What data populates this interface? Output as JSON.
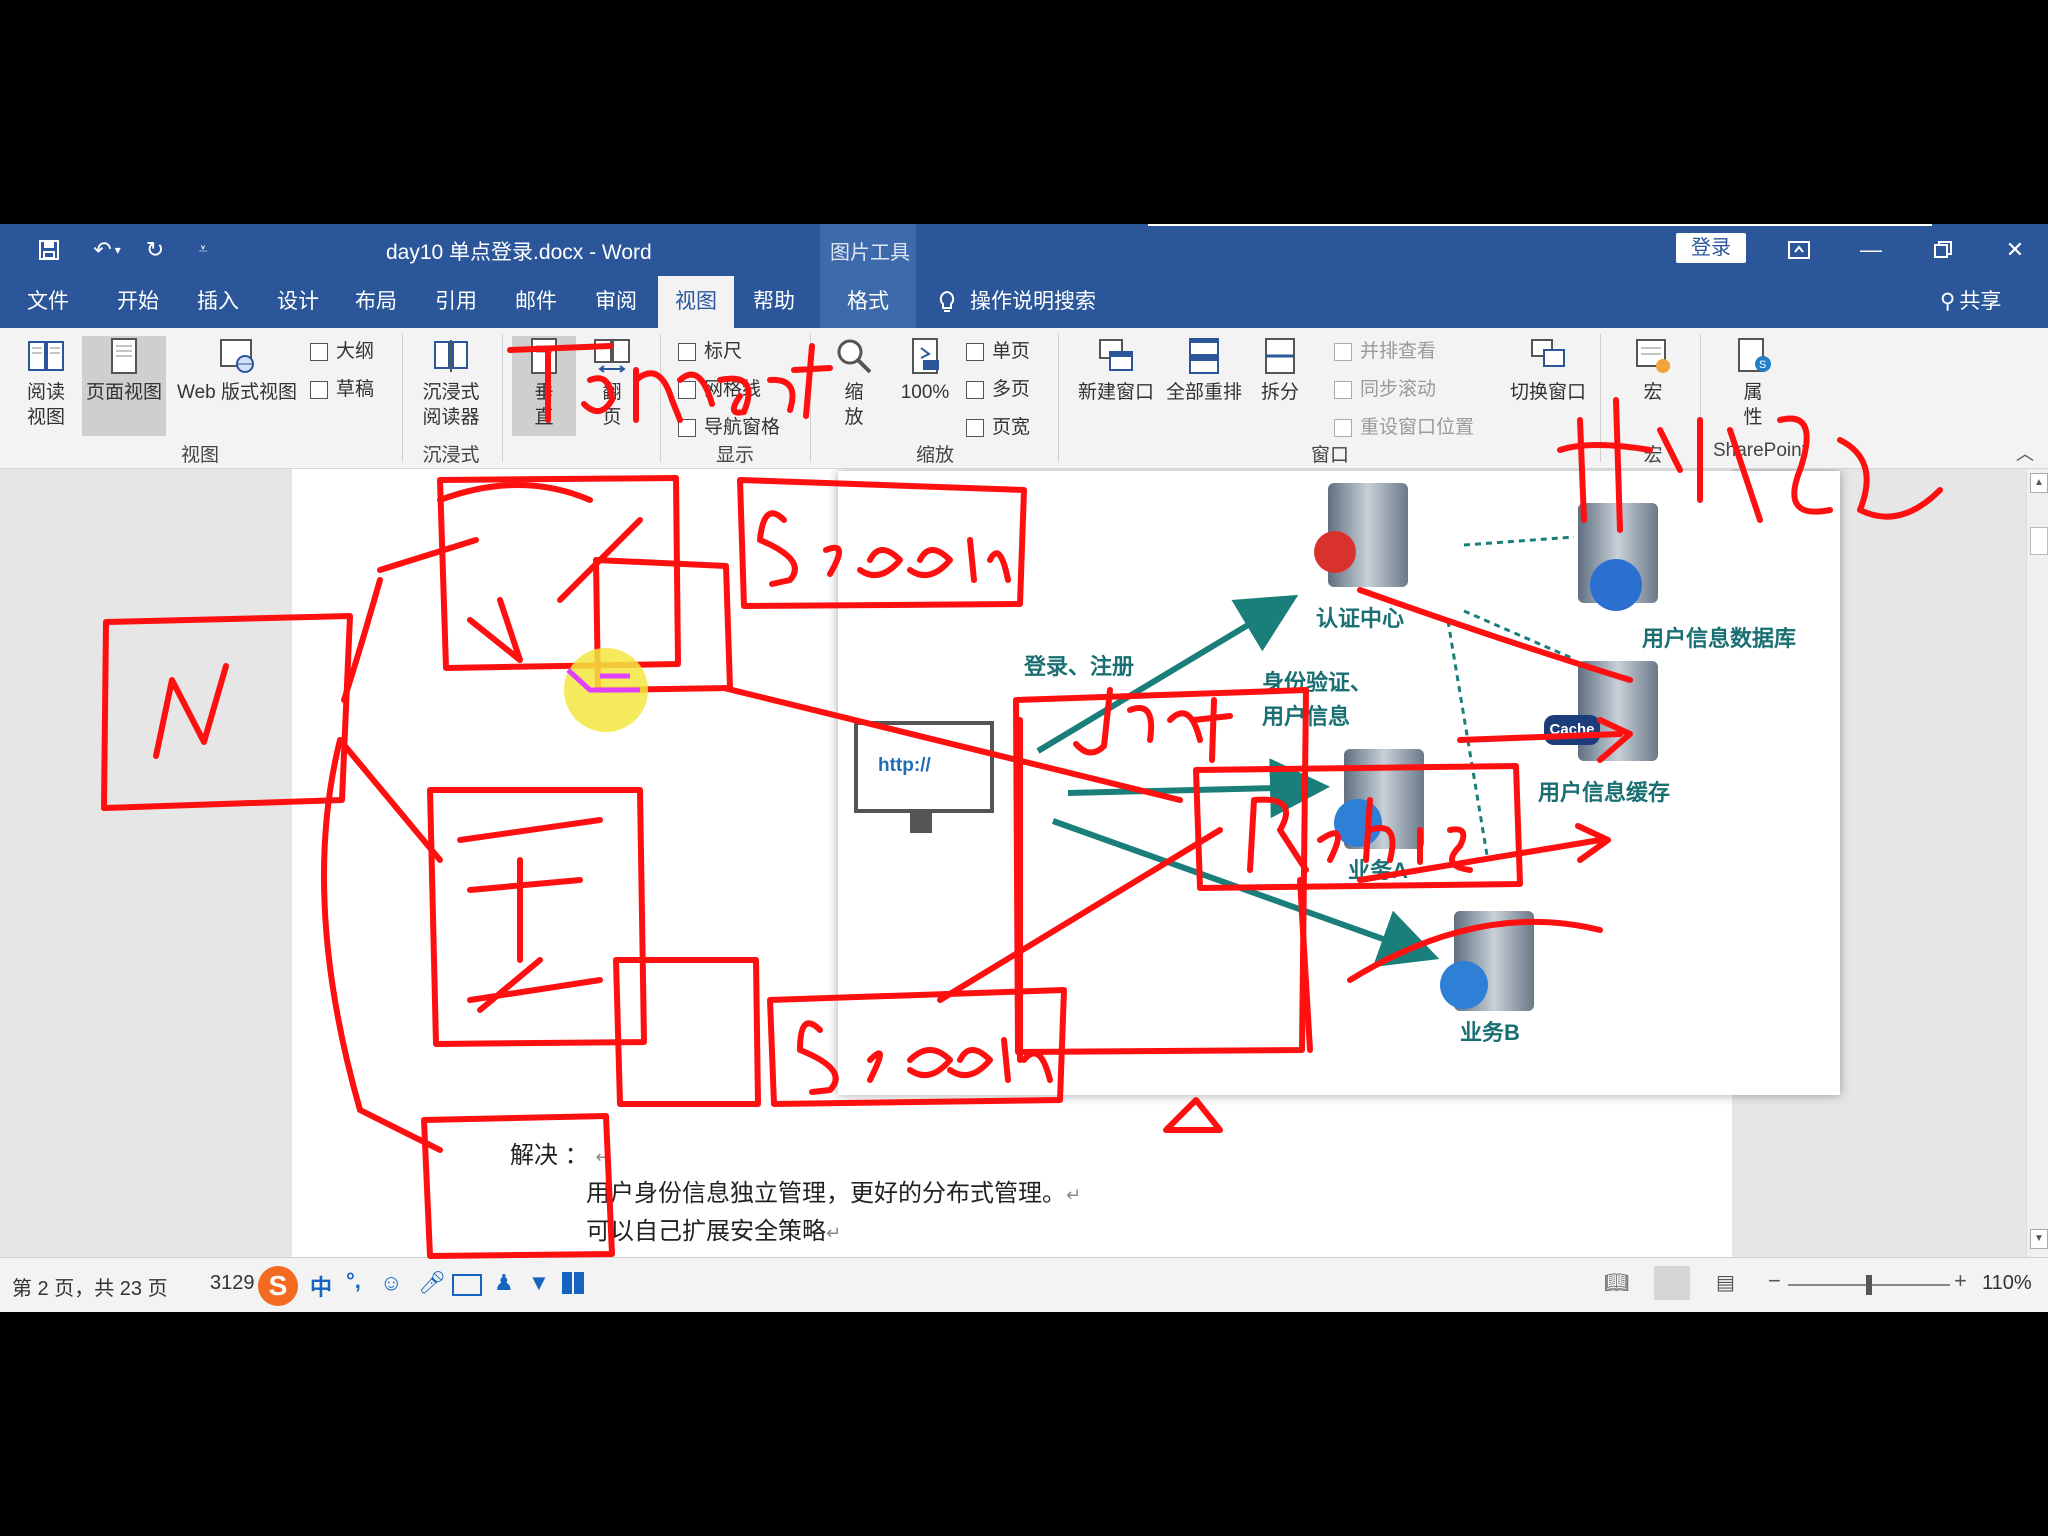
{
  "window": {
    "doc_title": "day10 单点登录.docx  -  Word",
    "context_group": "图片工具",
    "signin_label": "登录",
    "share_label": "共享"
  },
  "tabs": [
    {
      "label": "文件"
    },
    {
      "label": "开始"
    },
    {
      "label": "插入"
    },
    {
      "label": "设计"
    },
    {
      "label": "布局"
    },
    {
      "label": "引用"
    },
    {
      "label": "邮件"
    },
    {
      "label": "审阅"
    },
    {
      "label": "视图",
      "active": true
    },
    {
      "label": "帮助"
    },
    {
      "label": "格式"
    }
  ],
  "tell_me": "操作说明搜索",
  "ribbon": {
    "views": {
      "read_mode": "阅读\n视图",
      "print_layout": "页面视图",
      "web_layout": "Web 版式视图",
      "outline": "大纲",
      "draft": "草稿",
      "group": "视图"
    },
    "immersive": {
      "reader": "沉浸式\n阅读器",
      "group": "沉浸式"
    },
    "page_movement": {
      "vertical": "垂\n直",
      "side_to_side": "翻\n页"
    },
    "show": {
      "ruler": "标尺",
      "gridlines": "网格线",
      "nav_pane": "导航窗格",
      "group": "显示"
    },
    "zoom": {
      "zoom": "缩\n放",
      "hundred": "100%",
      "one_page": "单页",
      "multi_page": "多页",
      "page_width": "页宽",
      "group": "缩放"
    },
    "window": {
      "new_window": "新建窗口",
      "arrange_all": "全部重排",
      "split": "拆分",
      "side_by_side": "并排查看",
      "sync_scroll": "同步滚动",
      "reset_position": "重设窗口位置",
      "switch_windows": "切换窗口",
      "group": "窗口"
    },
    "macros": {
      "label": "宏",
      "group": "宏"
    },
    "sharepoint": {
      "label": "属\n性",
      "group": "SharePoint"
    }
  },
  "figure": {
    "login_register": "登录、注册",
    "auth_center": "认证中心",
    "identity_verify": "身份验证、",
    "user_info": "用户信息",
    "user_db": "用户信息数据库",
    "cache_badge": "Cache",
    "user_cache": "用户信息缓存",
    "business_a": "业务A",
    "business_b": "业务B",
    "browser_url": "http://"
  },
  "document": {
    "solution_label": "解决 ：",
    "line1": "用户身份信息独立管理，更好的分布式管理。",
    "line2": "可以自己扩展安全策略"
  },
  "statusbar": {
    "page_info": "第 2 页，共 23 页",
    "word_count": "3129",
    "ime_mode": "中",
    "punct": "°,",
    "zoom_level": "110%"
  },
  "handwriting": [
    "N",
    "Tomcat",
    "Session",
    "Jar",
    "Redis",
    "中小公司",
    "Session"
  ],
  "colors": {
    "word_blue": "#2b579a",
    "ink_red": "#ff1010",
    "arrow_teal": "#1a7f7a"
  }
}
